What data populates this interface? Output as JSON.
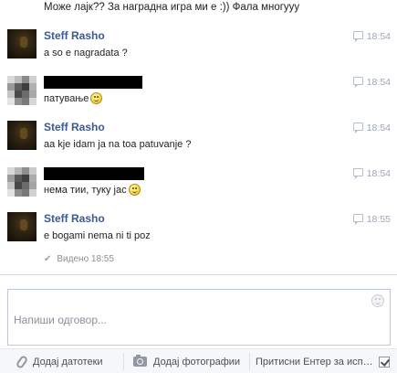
{
  "conversation": {
    "top_partial_message": "Може лајк?? За наградна игра ми е :)) Фала многууу",
    "messages": [
      {
        "sender": "Steff Rasho",
        "text": "a so e nagradata ?",
        "time": "18:54",
        "has_emoji": false
      },
      {
        "sender": "",
        "text": "патување",
        "time": "18:54",
        "has_emoji": true
      },
      {
        "sender": "Steff Rasho",
        "text": "aa kje idam ja na toa patuvanje ?",
        "time": "18:54",
        "has_emoji": false
      },
      {
        "sender": "",
        "text": "нема тии, туку јас",
        "time": "18:54",
        "has_emoji": true
      },
      {
        "sender": "Steff Rasho",
        "text": "e bogami nema ni ti poz",
        "time": "18:55",
        "has_emoji": false
      }
    ],
    "seen_status": "Видено 18:55"
  },
  "composer": {
    "placeholder": "Напиши одговор..."
  },
  "toolbar": {
    "attach_files_label": "Додај датотеки",
    "add_photos_label": "Додај фотографии",
    "enter_to_send_label": "Притисни Ентер за исп…"
  },
  "colors": {
    "name_link": "#3b5998",
    "timestamp": "#9da6b5",
    "redaction": "#000000",
    "toolbar_bg": "#f6f7f9"
  },
  "icons": {
    "timestamp": "chat-bubble-icon",
    "seen": "check-icon",
    "emoji": "smiley-emoji-icon",
    "attach": "paperclip-icon",
    "photo": "camera-icon"
  }
}
